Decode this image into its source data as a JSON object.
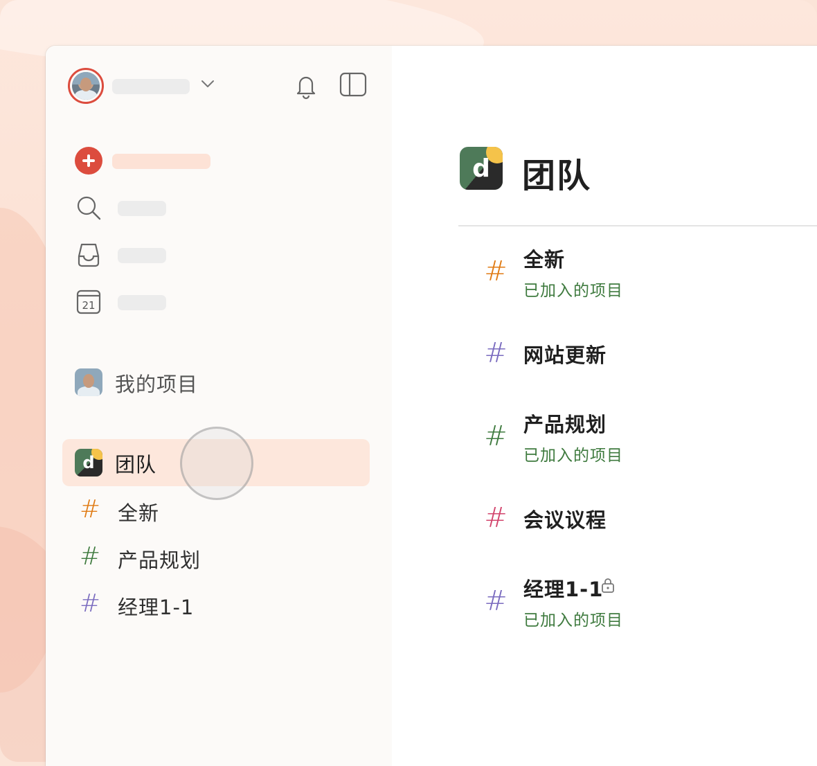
{
  "colors": {
    "accent_red": "#dc4c3e",
    "hash_orange": "#e07b14",
    "hash_green": "#3e7a3e",
    "hash_purple": "#7a6bbf",
    "hash_pink": "#d2446c",
    "joined_green": "#3e7a3e",
    "team_highlight": "#fde7dc"
  },
  "icons": {
    "bell": "bell-icon",
    "panel": "sidebar-toggle-icon",
    "add": "plus-circle-icon",
    "search": "search-icon",
    "inbox": "inbox-icon",
    "calendar": "calendar-icon",
    "lock": "lock-icon"
  },
  "sidebar": {
    "calendar_day": "21",
    "my_projects_label": "我的项目",
    "team_label": "团队",
    "team_logo_letter": "d",
    "projects": [
      {
        "name": "全新",
        "hash": "#",
        "color": "#e07b14"
      },
      {
        "name": "产品规划",
        "hash": "#",
        "color": "#3e7a3e"
      },
      {
        "name": "经理1-1",
        "hash": "#",
        "color": "#7a6bbf"
      }
    ]
  },
  "main": {
    "title": "团队",
    "logo_letter": "d",
    "projects": [
      {
        "name": "全新",
        "hash": "#",
        "color": "#e07b14",
        "status": "已加入的项目"
      },
      {
        "name": "网站更新",
        "hash": "#",
        "color": "#7a6bbf",
        "status": ""
      },
      {
        "name": "产品规划",
        "hash": "#",
        "color": "#3e7a3e",
        "status": "已加入的项目"
      },
      {
        "name": "会议议程",
        "hash": "#",
        "color": "#d2446c",
        "status": ""
      },
      {
        "name": "经理1-1",
        "hash": "#",
        "color": "#7a6bbf",
        "status": "已加入的项目",
        "locked": true
      }
    ]
  }
}
